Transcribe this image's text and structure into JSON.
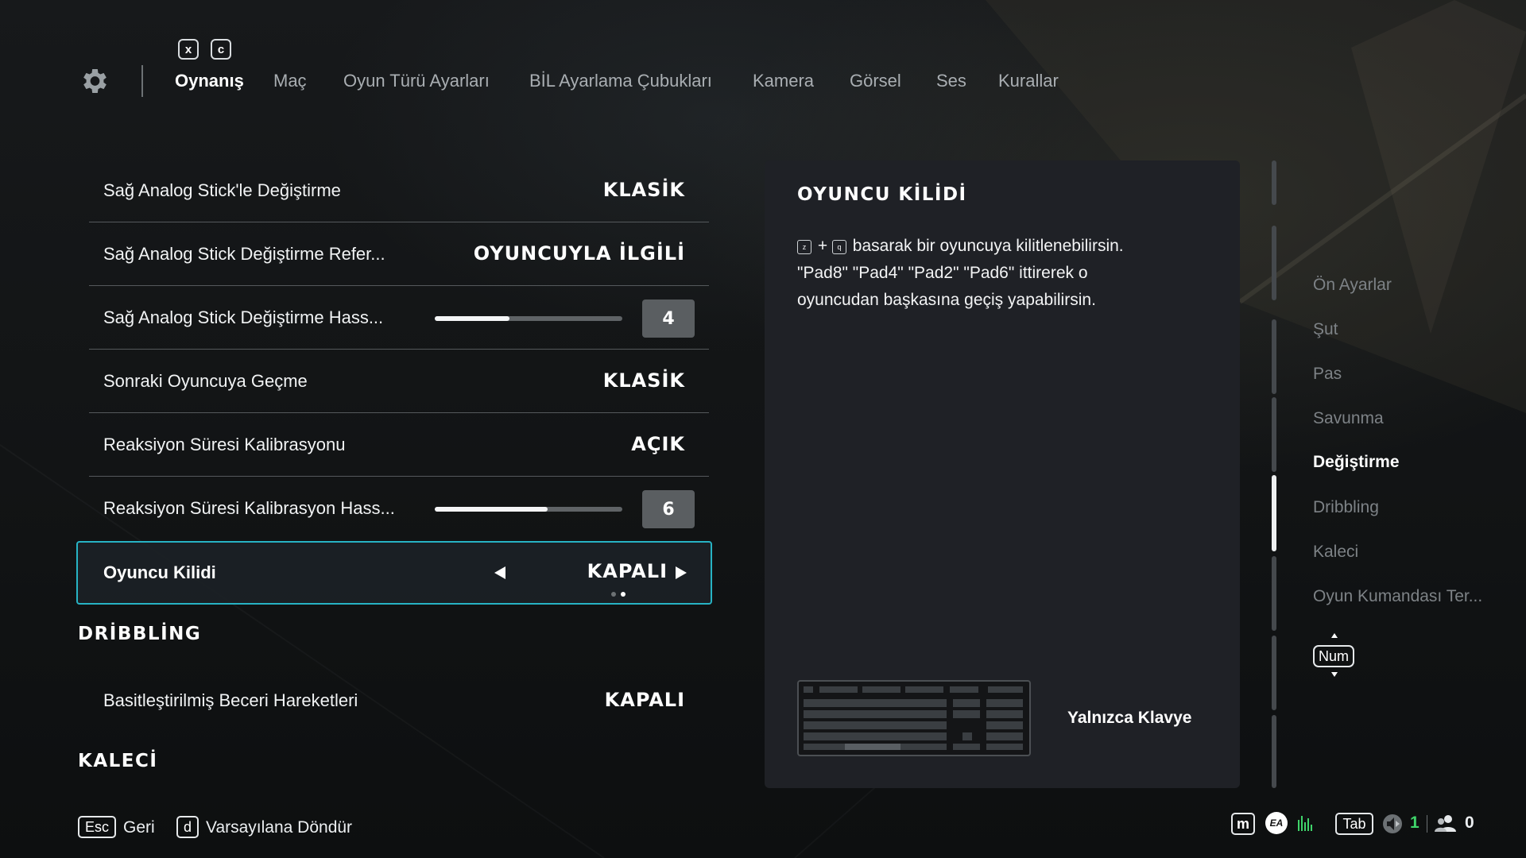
{
  "nav": {
    "hotkey_left": "x",
    "hotkey_right": "c",
    "tabs": [
      {
        "label": "Oynanış",
        "active": true
      },
      {
        "label": "Maç"
      },
      {
        "label": "Oyun Türü Ayarları"
      },
      {
        "label": "BİL Ayarlama Çubukları"
      },
      {
        "label": "Kamera"
      },
      {
        "label": "Görsel"
      },
      {
        "label": "Ses"
      },
      {
        "label": "Kurallar"
      }
    ]
  },
  "settings": [
    {
      "label": "Sağ Analog Stick'le Değiştirme",
      "value": "KLASİK"
    },
    {
      "label": "Sağ Analog Stick Değiştirme Refer...",
      "value": "OYUNCUYLA İLGİLİ"
    },
    {
      "label": "Sağ Analog Stick Değiştirme Hass...",
      "value": "4",
      "slider": 0.4
    },
    {
      "label": "Sonraki Oyuncuya Geçme",
      "value": "KLASİK"
    },
    {
      "label": "Reaksiyon Süresi Kalibrasyonu",
      "value": "AÇIK"
    },
    {
      "label": "Reaksiyon Süresi Kalibrasyon Hass...",
      "value": "6",
      "slider": 0.6
    }
  ],
  "selected_setting": {
    "label": "Oyuncu Kilidi",
    "value": "KAPALI",
    "option_index": 2,
    "option_count": 2
  },
  "sections": [
    {
      "title": "DRİBBLİNG",
      "items": [
        {
          "label": "Basitleştirilmiş Beceri Hareketleri",
          "value": "KAPALI"
        }
      ]
    },
    {
      "title": "KALECİ"
    }
  ],
  "info_panel": {
    "title": "OYUNCU KİLİDİ",
    "key1": "z",
    "plus": "+",
    "key2": "q",
    "line1_rest": "basarak bir oyuncuya kilitlenebilirsin.",
    "line2": "\"Pad8\" \"Pad4\" \"Pad2\" \"Pad6\" ittirerek o",
    "line3": "oyuncudan başkasına geçiş yapabilirsin.",
    "device_label": "Yalnızca Klavye",
    "device_icon": "keyboard-icon"
  },
  "right_nav": {
    "items": [
      {
        "label": "Ön Ayarlar"
      },
      {
        "label": "Şut"
      },
      {
        "label": "Pas"
      },
      {
        "label": "Savunma"
      },
      {
        "label": "Değiştirme",
        "active": true
      },
      {
        "label": "Dribbling"
      },
      {
        "label": "Kaleci"
      },
      {
        "label": "Oyun Kumandası Ter..."
      }
    ],
    "scroll_key": "Num"
  },
  "footer": {
    "back_key": "Esc",
    "back_label": "Geri",
    "reset_key": "d",
    "reset_label": "Varsayılana Döndür"
  },
  "status_bar": {
    "menu_key": "m",
    "ea_label": "EA",
    "tab_key": "Tab",
    "voice_count": "1",
    "party_count": "0",
    "accent_green": "#3fd46a",
    "accent_cyan": "#27b3c4"
  }
}
